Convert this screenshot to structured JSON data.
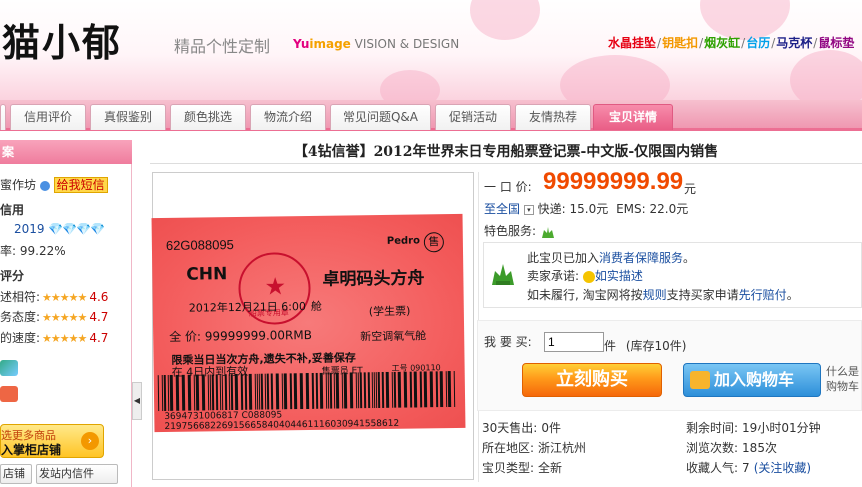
{
  "header": {
    "logo_text": "猫小郁",
    "tagline": "精品个性定制",
    "subbrand_yu": "Yu",
    "subbrand_image": "image",
    "subbrand_rest": " VISION & DESIGN",
    "links": [
      {
        "label": "水晶挂坠",
        "color": "#e60012"
      },
      {
        "label": "钥匙扣",
        "color": "#f39800"
      },
      {
        "label": "烟灰缸",
        "color": "#2ea100"
      },
      {
        "label": "台历",
        "color": "#00a0e9"
      },
      {
        "label": "马克杯",
        "color": "#1d2088"
      },
      {
        "label": "鼠标垫",
        "color": "#920783"
      }
    ]
  },
  "nav": {
    "tabs": [
      "信用评价",
      "真假鉴别",
      "颜色挑选",
      "物流介绍",
      "常见问题Q&A",
      "促销活动",
      "友情热荐",
      "宝贝详情"
    ],
    "active": "宝贝详情"
  },
  "sidebar": {
    "head": "案",
    "contact": {
      "prefix": "蜜作坊",
      "sms": "给我短信"
    },
    "credit_title": "信用",
    "credit_year": "2019",
    "credit_icons": "💎💎💎💎",
    "rate_label": "率:",
    "rate_value": "99.22%",
    "score_title": "评分",
    "scores": [
      {
        "label": "述相符:",
        "value": "4.6",
        "stars": "★★★★★"
      },
      {
        "label": "务态度:",
        "value": "4.7",
        "stars": "★★★★★"
      },
      {
        "label": "的速度:",
        "value": "4.7",
        "stars": "★★★★★"
      }
    ],
    "promo_line1": "选更多商品",
    "promo_line2": "入掌柜店铺",
    "promo_go": "›",
    "btn_store": "店铺",
    "btn_mail": "发站内信件",
    "collapse_glyph": "◀"
  },
  "item": {
    "title": "【4钻信誉】2012年世界末日专用船票登记票-中文版-仅限国内销售",
    "price_label": "一 口 价:",
    "price": "99999999.99",
    "price_unit": "元",
    "ship_to": "至全国",
    "shipping_express": "快递: 15.0元",
    "shipping_ems": "EMS: 22.0元",
    "feature_label": "特色服务:",
    "guarantee": {
      "line1_prefix": "此宝贝已加入",
      "line1_link": "消费者保障服务",
      "line1_suffix": "。",
      "line2_label": "卖家承诺:",
      "line2_link": "如实描述",
      "line3_prefix": "如未履行, 淘宝网将按",
      "line3_link1": "规则",
      "line3_mid": "支持买家申请",
      "line3_link2": "先行赔付",
      "line3_suffix": "。"
    },
    "qty_label": "我 要 买:",
    "qty_value": "1",
    "qty_unit": "件",
    "stock": "(库存10件)",
    "buy_now": "立刻购买",
    "add_cart": "加入购物车",
    "side_note1": "什么是",
    "side_note2": "购物车"
  },
  "ticket": {
    "code": "62G088095",
    "pedro": "Pedro",
    "shou": "售",
    "chn": "CHN",
    "ship": "卓明码头方舟",
    "date": "2012年12月21日 6:00",
    "cabin_short": "舱",
    "student": "(学生票)",
    "price_line": "全 价: 99999999.00RMB",
    "cabin_type": "新空调氧气舱",
    "warning": "限乘当日当次方舟,遗失不补,妥善保存",
    "valid": "在 4日内到有效",
    "seller": "售票员 ET",
    "worker": "工号 090110",
    "stamp_label": "船票专用章",
    "barcode_number": "3694731006817 C088095 2197566822691566584040446111603094155861​2"
  },
  "stats": [
    {
      "label": "30天售出:",
      "value": "0件"
    },
    {
      "label": "剩余时间:",
      "value": "19小时01分钟"
    },
    {
      "label": "所在地区:",
      "value": "浙江杭州"
    },
    {
      "label": "浏览次数:",
      "value": "185次"
    },
    {
      "label": "宝贝类型:",
      "value": "全新"
    },
    {
      "label": "收藏人气:",
      "value": "7",
      "extra": "(关注收藏)"
    }
  ],
  "colors": {
    "accent_pink": "#ec6f93",
    "price_orange": "#f04a00",
    "link_blue": "#1b4fa0"
  }
}
